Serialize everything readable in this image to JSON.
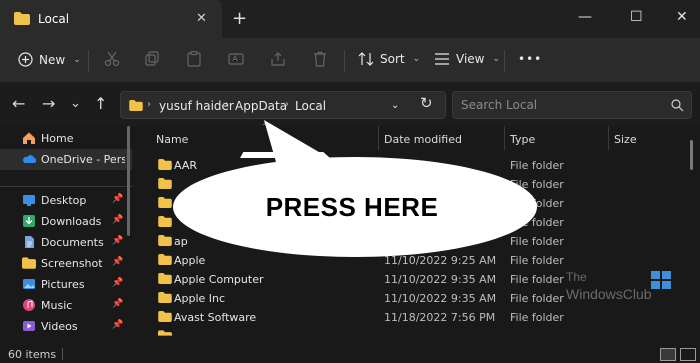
{
  "window": {
    "tab_title": "Local",
    "new_tab_glyph": "+",
    "close_glyph": "✕",
    "minimize_glyph": "—",
    "maximize_glyph": "☐",
    "window_close_glyph": "✕"
  },
  "toolbar": {
    "new_label": "New",
    "sort_label": "Sort",
    "view_label": "View",
    "more_glyph": "•••",
    "icons": [
      "cut-icon",
      "copy-icon",
      "paste-icon",
      "rename-icon",
      "share-icon",
      "delete-icon"
    ]
  },
  "address": {
    "crumbs": [
      "yusuf haider",
      "AppData",
      "Local"
    ],
    "search_placeholder": "Search Local"
  },
  "sidebar": {
    "items": [
      {
        "label": "Home",
        "pinned": false,
        "icon": "home-icon"
      },
      {
        "label": "OneDrive - Person",
        "pinned": false,
        "icon": "onedrive-icon"
      },
      {
        "label": "Desktop",
        "pinned": true,
        "icon": "desktop-icon"
      },
      {
        "label": "Downloads",
        "pinned": true,
        "icon": "downloads-icon"
      },
      {
        "label": "Documents",
        "pinned": true,
        "icon": "documents-icon"
      },
      {
        "label": "Screenshot",
        "pinned": true,
        "icon": "folder-icon"
      },
      {
        "label": "Pictures",
        "pinned": true,
        "icon": "pictures-icon"
      },
      {
        "label": "Music",
        "pinned": true,
        "icon": "music-icon"
      },
      {
        "label": "Videos",
        "pinned": true,
        "icon": "videos-icon"
      }
    ],
    "pin_glyph": "📌"
  },
  "list": {
    "columns": [
      "Name",
      "Date modified",
      "Type",
      "Size"
    ],
    "rows": [
      {
        "name": "AAR",
        "date": "",
        "type": "File folder"
      },
      {
        "name": "",
        "date": "",
        "type": "File folder"
      },
      {
        "name": "",
        "date": "",
        "type": "File folder"
      },
      {
        "name": "",
        "date": "",
        "type": "File folder"
      },
      {
        "name": "ap",
        "date": "",
        "type": "File folder"
      },
      {
        "name": "Apple",
        "date": "11/10/2022 9:25 AM",
        "type": "File folder"
      },
      {
        "name": "Apple Computer",
        "date": "11/10/2022 9:35 AM",
        "type": "File folder"
      },
      {
        "name": "Apple Inc",
        "date": "11/10/2022 9:35 AM",
        "type": "File folder"
      },
      {
        "name": "Avast Software",
        "date": "11/18/2022 7:56 PM",
        "type": "File folder"
      }
    ]
  },
  "status": {
    "item_count": "60 items"
  },
  "callout": {
    "text": "PRESS HERE"
  },
  "watermark": {
    "line1": "The",
    "line2": "WindowsClub"
  },
  "colors": {
    "accent": "#4cc2ff",
    "folder": "#f0c24a",
    "bg": "#191919"
  }
}
